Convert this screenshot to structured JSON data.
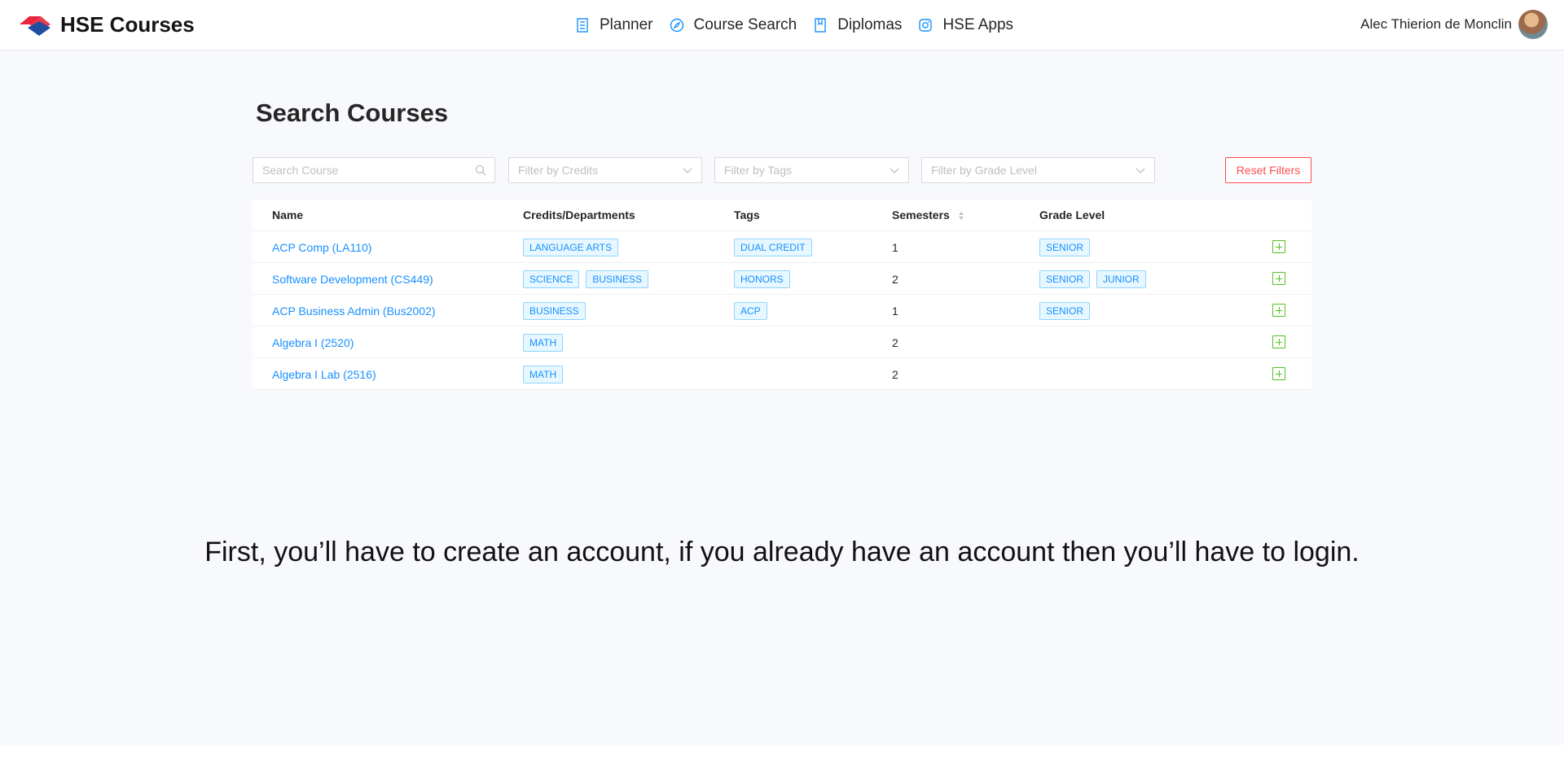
{
  "header": {
    "brand": "HSE Courses",
    "nav": [
      {
        "label": "Planner",
        "icon": "planner-icon"
      },
      {
        "label": "Course Search",
        "icon": "compass-icon"
      },
      {
        "label": "Diplomas",
        "icon": "book-icon"
      },
      {
        "label": "HSE Apps",
        "icon": "instagram-icon"
      }
    ],
    "user_name": "Alec Thierion de Monclin"
  },
  "page": {
    "title": "Search Courses"
  },
  "filters": {
    "search_placeholder": "Search Course",
    "credits_placeholder": "Filter by Credits",
    "tags_placeholder": "Filter by Tags",
    "grade_placeholder": "Filter by Grade Level",
    "reset_label": "Reset Filters"
  },
  "table": {
    "columns": [
      "Name",
      "Credits/Departments",
      "Tags",
      "Semesters",
      "Grade Level"
    ],
    "rows": [
      {
        "name": "ACP Comp (LA110)",
        "departments": [
          "LANGUAGE ARTS"
        ],
        "tags": [
          "DUAL CREDIT"
        ],
        "semesters": "1",
        "grades": [
          "SENIOR"
        ]
      },
      {
        "name": "Software Development (CS449)",
        "departments": [
          "SCIENCE",
          "BUSINESS"
        ],
        "tags": [
          "HONORS"
        ],
        "semesters": "2",
        "grades": [
          "SENIOR",
          "JUNIOR"
        ]
      },
      {
        "name": "ACP Business Admin (Bus2002)",
        "departments": [
          "BUSINESS"
        ],
        "tags": [
          "ACP"
        ],
        "semesters": "1",
        "grades": [
          "SENIOR"
        ]
      },
      {
        "name": "Algebra I (2520)",
        "departments": [
          "MATH"
        ],
        "tags": [],
        "semesters": "2",
        "grades": []
      },
      {
        "name": "Algebra I Lab (2516)",
        "departments": [
          "MATH"
        ],
        "tags": [],
        "semesters": "2",
        "grades": []
      }
    ]
  },
  "caption": "First, you’ll have to create an account, if you already have an account then you’ll have to login.",
  "colors": {
    "accent": "#1890ff",
    "danger": "#ff4d4f",
    "success": "#52c41a",
    "logo_red": "#e8253b",
    "logo_blue": "#1f4e9e"
  }
}
